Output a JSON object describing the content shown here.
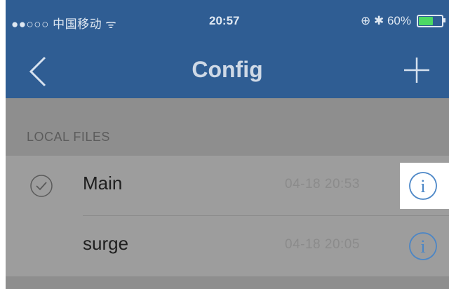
{
  "status_bar": {
    "carrier": "●●○○○ 中国移动 ᯤ",
    "time": "20:57",
    "right_icons": "⊕ ✱ 60%",
    "battery_color": "#4cd964"
  },
  "nav": {
    "title": "Config",
    "back_icon": "chevron-left-icon",
    "add_icon": "plus-icon",
    "bar_color": "#2f5d93"
  },
  "section": {
    "header": "LOCAL FILES"
  },
  "files": [
    {
      "name": "Main",
      "date": "04-18 20:53",
      "selected": true
    },
    {
      "name": "surge",
      "date": "04-18 20:05",
      "selected": false
    }
  ],
  "colors": {
    "info_icon": "#4b86c6",
    "background_dim": "#8e8e8e"
  }
}
